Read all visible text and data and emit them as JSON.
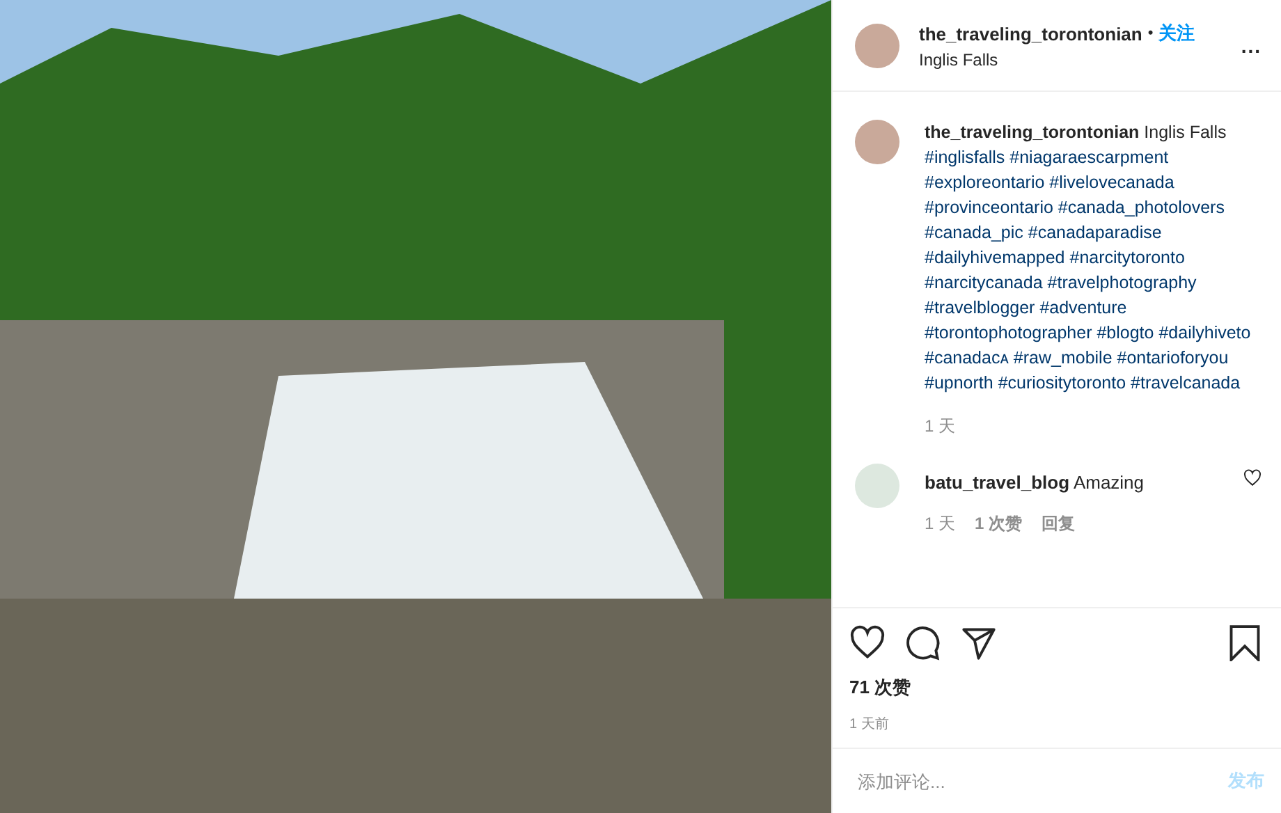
{
  "post_header": {
    "username": "the_traveling_torontonian",
    "separator": "•",
    "follow": "关注",
    "location": "Inglis Falls",
    "more": "..."
  },
  "caption": {
    "username": "the_traveling_torontonian",
    "text": "Inglis Falls",
    "hashtags": [
      "#inglisfalls",
      "#niagaraescarpment",
      "#exploreontario",
      "#livelovecanada",
      "#provinceontario",
      "#canada_photolovers",
      "#canada_pic",
      "#canadaparadise",
      "#dailyhivemapped",
      "#narcitytoronto",
      "#narcitycanada",
      "#travelphotography",
      "#travelblogger",
      "#adventure",
      "#torontophotographer",
      "#blogto",
      "#dailyhiveto",
      "#canadacᴀ",
      "#raw_mobile",
      "#ontarioforyou",
      "#upnorth",
      "#curiositytoronto",
      "#travelcanada"
    ],
    "time": "1 天"
  },
  "comments": [
    {
      "username": "batu_travel_blog",
      "text": "Amazing",
      "time": "1 天",
      "likes": "1 次赞",
      "reply": "回复"
    }
  ],
  "likes": "71 次赞",
  "posted": "1 天前",
  "comment_box": {
    "placeholder": "添加评论...",
    "post_button": "发布",
    "disabled": true
  }
}
